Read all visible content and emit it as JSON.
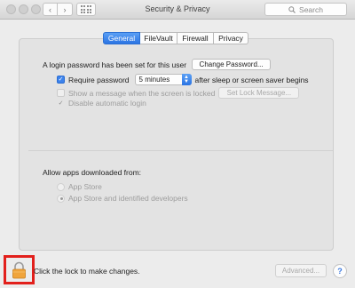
{
  "window": {
    "title": "Security & Privacy",
    "search_placeholder": "Search",
    "nav_back": "‹",
    "nav_forward": "›"
  },
  "tabs": [
    {
      "label": "General",
      "active": true
    },
    {
      "label": "FileVault",
      "active": false
    },
    {
      "label": "Firewall",
      "active": false
    },
    {
      "label": "Privacy",
      "active": false
    }
  ],
  "general": {
    "login_password_text": "A login password has been set for this user",
    "change_password_label": "Change Password...",
    "require_password": {
      "label": "Require password",
      "checked": true
    },
    "require_password_delay": "5 minutes",
    "require_password_suffix": "after sleep or screen saver begins",
    "show_message": {
      "label": "Show a message when the screen is locked",
      "checked": false
    },
    "set_lock_message_label": "Set Lock Message...",
    "disable_auto_login": {
      "label": "Disable automatic login",
      "checked": true
    }
  },
  "apps": {
    "heading": "Allow apps downloaded from:",
    "options": [
      {
        "label": "App Store",
        "selected": false
      },
      {
        "label": "App Store and identified developers",
        "selected": true
      }
    ]
  },
  "footer": {
    "lock_text": "Click the lock to make changes.",
    "advanced_label": "Advanced...",
    "help_label": "?"
  },
  "colors": {
    "accent": "#2b74e3",
    "highlight_box": "#e2201c",
    "lock_body": "#f0a43b"
  }
}
